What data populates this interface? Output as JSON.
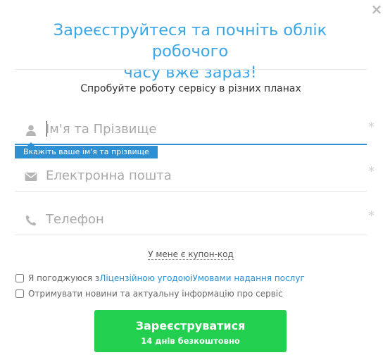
{
  "dialog": {
    "close_symbol": "×",
    "title_line1": "Зареєструйтеся та почніть облік робочого",
    "title_line2": "часу вже зараз!",
    "subtitle": "Спробуйте роботу сервісу в різних планах"
  },
  "form": {
    "name": {
      "placeholder": "Ім'я та Прізвище",
      "icon": "user-icon",
      "required_mark": "*"
    },
    "tooltip": "Вкажіть ваше ім'я та прізвище",
    "email": {
      "placeholder": "Електронна пошта",
      "icon": "envelope-icon",
      "required_mark": "*"
    },
    "phone": {
      "placeholder": "Телефон",
      "icon": "phone-icon",
      "required_mark": "*"
    },
    "coupon_link": "У мене є купон-код",
    "agree": {
      "prefix": "Я погоджуюся з ",
      "license_link": "Ліцензійною угодою",
      "and": " і ",
      "terms_link": "Умовами надання послуг",
      "checked": false
    },
    "news": {
      "label": "Отримувати новини та актуальну інформацію про сервіс",
      "checked": false
    },
    "submit": {
      "label": "Зареєструватися",
      "sub_label": "14 днів безкоштовно"
    }
  },
  "colors": {
    "accent": "#3aa6e6",
    "focus_line": "#2f8fd3",
    "button": "#22cf4f",
    "icon": "#b5b5b5"
  }
}
